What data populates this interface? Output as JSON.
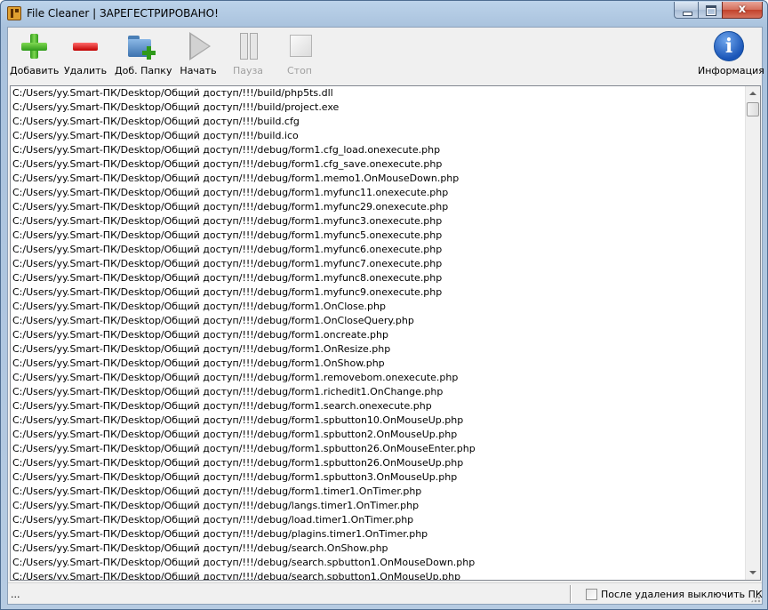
{
  "window": {
    "title": "File Cleaner | ЗАРЕГЕСТРИРОВАНО!",
    "close_glyph": "x"
  },
  "toolbar": {
    "add_label": "Добавить",
    "delete_label": "Удалить",
    "add_folder_label": "Доб. Папку",
    "start_label": "Начать",
    "pause_label": "Пауза",
    "stop_label": "Стоп",
    "info_label": "Информация"
  },
  "file_list": {
    "items": [
      "C:/Users/yy.Smart-ПК/Desktop/Общий доступ/!!!/build/php5ts.dll",
      "C:/Users/yy.Smart-ПК/Desktop/Общий доступ/!!!/build/project.exe",
      "C:/Users/yy.Smart-ПК/Desktop/Общий доступ/!!!/build.cfg",
      "C:/Users/yy.Smart-ПК/Desktop/Общий доступ/!!!/build.ico",
      "C:/Users/yy.Smart-ПК/Desktop/Общий доступ/!!!/debug/form1.cfg_load.onexecute.php",
      "C:/Users/yy.Smart-ПК/Desktop/Общий доступ/!!!/debug/form1.cfg_save.onexecute.php",
      "C:/Users/yy.Smart-ПК/Desktop/Общий доступ/!!!/debug/form1.memo1.OnMouseDown.php",
      "C:/Users/yy.Smart-ПК/Desktop/Общий доступ/!!!/debug/form1.myfunc11.onexecute.php",
      "C:/Users/yy.Smart-ПК/Desktop/Общий доступ/!!!/debug/form1.myfunc29.onexecute.php",
      "C:/Users/yy.Smart-ПК/Desktop/Общий доступ/!!!/debug/form1.myfunc3.onexecute.php",
      "C:/Users/yy.Smart-ПК/Desktop/Общий доступ/!!!/debug/form1.myfunc5.onexecute.php",
      "C:/Users/yy.Smart-ПК/Desktop/Общий доступ/!!!/debug/form1.myfunc6.onexecute.php",
      "C:/Users/yy.Smart-ПК/Desktop/Общий доступ/!!!/debug/form1.myfunc7.onexecute.php",
      "C:/Users/yy.Smart-ПК/Desktop/Общий доступ/!!!/debug/form1.myfunc8.onexecute.php",
      "C:/Users/yy.Smart-ПК/Desktop/Общий доступ/!!!/debug/form1.myfunc9.onexecute.php",
      "C:/Users/yy.Smart-ПК/Desktop/Общий доступ/!!!/debug/form1.OnClose.php",
      "C:/Users/yy.Smart-ПК/Desktop/Общий доступ/!!!/debug/form1.OnCloseQuery.php",
      "C:/Users/yy.Smart-ПК/Desktop/Общий доступ/!!!/debug/form1.oncreate.php",
      "C:/Users/yy.Smart-ПК/Desktop/Общий доступ/!!!/debug/form1.OnResize.php",
      "C:/Users/yy.Smart-ПК/Desktop/Общий доступ/!!!/debug/form1.OnShow.php",
      "C:/Users/yy.Smart-ПК/Desktop/Общий доступ/!!!/debug/form1.removebom.onexecute.php",
      "C:/Users/yy.Smart-ПК/Desktop/Общий доступ/!!!/debug/form1.richedit1.OnChange.php",
      "C:/Users/yy.Smart-ПК/Desktop/Общий доступ/!!!/debug/form1.search.onexecute.php",
      "C:/Users/yy.Smart-ПК/Desktop/Общий доступ/!!!/debug/form1.spbutton10.OnMouseUp.php",
      "C:/Users/yy.Smart-ПК/Desktop/Общий доступ/!!!/debug/form1.spbutton2.OnMouseUp.php",
      "C:/Users/yy.Smart-ПК/Desktop/Общий доступ/!!!/debug/form1.spbutton26.OnMouseEnter.php",
      "C:/Users/yy.Smart-ПК/Desktop/Общий доступ/!!!/debug/form1.spbutton26.OnMouseUp.php",
      "C:/Users/yy.Smart-ПК/Desktop/Общий доступ/!!!/debug/form1.spbutton3.OnMouseUp.php",
      "C:/Users/yy.Smart-ПК/Desktop/Общий доступ/!!!/debug/form1.timer1.OnTimer.php",
      "C:/Users/yy.Smart-ПК/Desktop/Общий доступ/!!!/debug/langs.timer1.OnTimer.php",
      "C:/Users/yy.Smart-ПК/Desktop/Общий доступ/!!!/debug/load.timer1.OnTimer.php",
      "C:/Users/yy.Smart-ПК/Desktop/Общий доступ/!!!/debug/plagins.timer1.OnTimer.php",
      "C:/Users/yy.Smart-ПК/Desktop/Общий доступ/!!!/debug/search.OnShow.php",
      "C:/Users/yy.Smart-ПК/Desktop/Общий доступ/!!!/debug/search.spbutton1.OnMouseDown.php",
      "C:/Users/yy.Smart-ПК/Desktop/Общий доступ/!!!/debug/search.spbutton1.OnMouseUp.php"
    ]
  },
  "status": {
    "text": "...",
    "shutdown_label": "После удаления выключить ПК",
    "shutdown_checked": false
  }
}
